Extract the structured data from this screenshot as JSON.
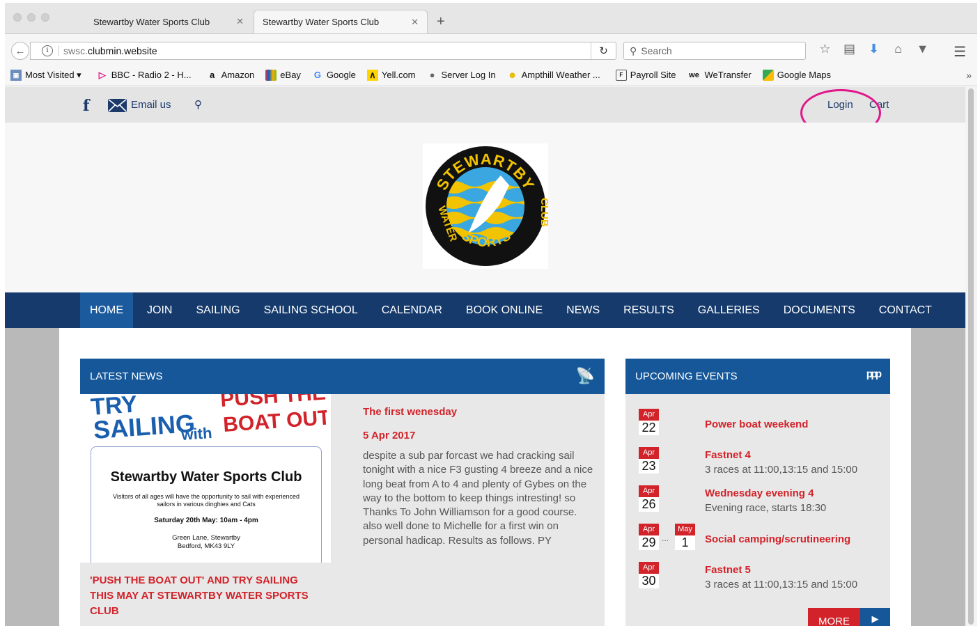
{
  "browser": {
    "tabs": [
      {
        "title": "Stewartby Water Sports Club",
        "close": "✕"
      },
      {
        "title": "Stewartby Water Sports Club",
        "close": "✕"
      }
    ],
    "new_tab": "+",
    "url_prefix": "swsc.",
    "url_host": "clubmin.website",
    "search_placeholder": "Search",
    "bookmarks": [
      {
        "label": "Most Visited ▾",
        "icon": "folder-icon"
      },
      {
        "label": "BBC - Radio 2 - H...",
        "icon": "bbc-radio-icon"
      },
      {
        "label": "Amazon",
        "icon": "amazon-icon"
      },
      {
        "label": "eBay",
        "icon": "ebay-icon"
      },
      {
        "label": "Google",
        "icon": "google-icon"
      },
      {
        "label": "Yell.com",
        "icon": "yell-icon"
      },
      {
        "label": "Server Log In",
        "icon": "globe-icon"
      },
      {
        "label": "Ampthill Weather ...",
        "icon": "weather-icon"
      },
      {
        "label": "Payroll Site",
        "icon": "payroll-icon"
      },
      {
        "label": "WeTransfer",
        "icon": "wetransfer-icon"
      },
      {
        "label": "Google Maps",
        "icon": "maps-icon"
      }
    ],
    "bookmarks_more": "»"
  },
  "site": {
    "topbar": {
      "email_label": "Email us",
      "login_label": "Login",
      "cart_label": "Cart"
    },
    "logo": {
      "top_text": "STEWARTBY",
      "left_text": "WATER",
      "bottom_text": "SPORTS",
      "right_text": "CLUB"
    },
    "nav": [
      "HOME",
      "JOIN",
      "SAILING",
      "SAILING SCHOOL",
      "CALENDAR",
      "BOOK ONLINE",
      "NEWS",
      "RESULTS",
      "GALLERIES",
      "DOCUMENTS",
      "CONTACT"
    ],
    "news": {
      "heading": "LATEST NEWS",
      "flyer": {
        "try": "TRY",
        "sailing": "SAILING",
        "with": "with",
        "push": "PUSH THE",
        "boat_out": "BOAT OUT",
        "club": "Stewartby Water Sports Club",
        "line1": "Visitors of all ages will have the opportunity to sail with experienced",
        "line2": "sailors in various dinghies and Cats",
        "date": "Saturday 20th May: 10am - 4pm",
        "addr1": "Green Lane, Stewartby",
        "addr2": "Bedford, MK43 9LY"
      },
      "caption": "'PUSH THE BOAT OUT' AND TRY SAILING THIS MAY AT STEWARTBY WATER SPORTS CLUB",
      "article_title": "The first wenesday",
      "article_date": "5 Apr 2017",
      "article_body": "despite a sub par forcast we had cracking sail tonight with a nice F3 gusting 4 breeze and a nice long beat from A to 4 and plenty of Gybes on the way to the bottom to keep things intresting! so Thanks To John Williamson for a good course. also well done to Michelle for a first win on personal hadicap. Results as follows. PY"
    },
    "events": {
      "heading": "UPCOMING EVENTS",
      "items": [
        {
          "month": "Apr",
          "day": "22",
          "title": "Power boat weekend",
          "sub": ""
        },
        {
          "month": "Apr",
          "day": "23",
          "title": "Fastnet 4",
          "sub": "3 races at 11:00,13:15 and 15:00"
        },
        {
          "month": "Apr",
          "day": "26",
          "title": "Wednesday evening 4",
          "sub": "Evening race, starts 18:30"
        },
        {
          "month": "Apr",
          "day": "29",
          "month2": "May",
          "day2": "1",
          "dots": "...",
          "title": "Social camping/scrutineering",
          "sub": ""
        },
        {
          "month": "Apr",
          "day": "30",
          "title": "Fastnet 5",
          "sub": "3 races at 11:00,13:15 and 15:00"
        }
      ],
      "more_label": "MORE",
      "more_arrow": "▶"
    }
  }
}
